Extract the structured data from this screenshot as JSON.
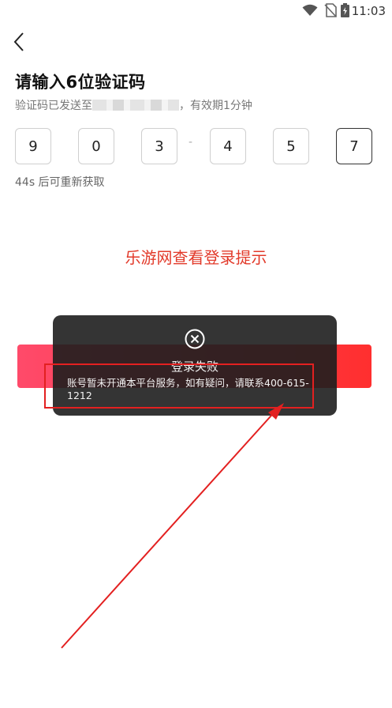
{
  "status_bar": {
    "time": "11:03",
    "icons": [
      "wifi-icon",
      "sim-icon",
      "battery-icon"
    ]
  },
  "header": {
    "back_icon": "chevron-left-icon"
  },
  "page": {
    "title": "请输入6位验证码",
    "subtitle_prefix": "验证码已发送至",
    "subtitle_suffix": "，有效期1分钟",
    "code_digits": [
      "9",
      "0",
      "3",
      "4",
      "5",
      "7"
    ],
    "code_separator": "-",
    "resend_text": "44s 后可重新获取",
    "site_hint": "乐游网查看登录提示"
  },
  "toast": {
    "icon": "close-circle-icon",
    "title": "登录失败",
    "message": "账号暂未开通本平台服务，如有疑问，请联系400-615-1212"
  },
  "colors": {
    "accent_red": "#e23a2a",
    "button_gradient_start": "#ff4a6a",
    "button_gradient_end": "#ff2f2f",
    "annotation_red": "#e32020",
    "toast_bg": "#1e1e1e"
  }
}
